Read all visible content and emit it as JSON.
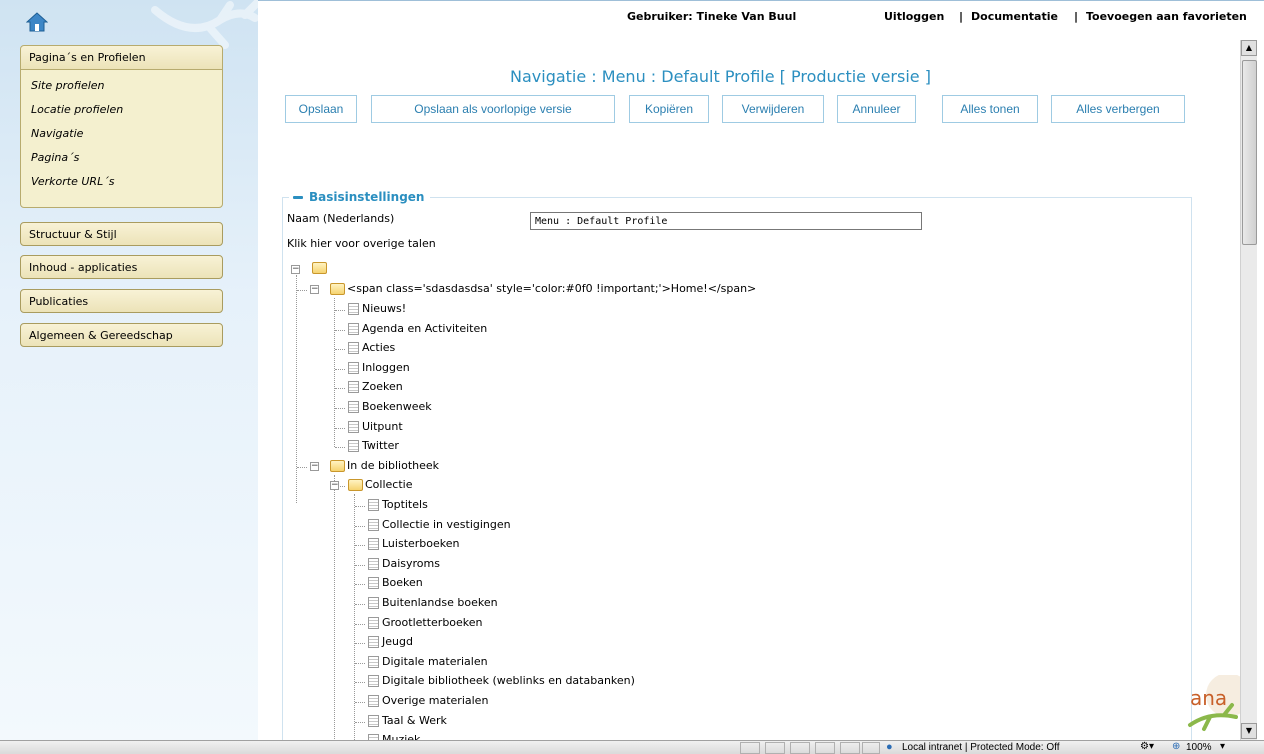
{
  "topbar": {
    "user": "Gebruiker: Tineke Van Buul",
    "logout": "Uitloggen",
    "sep1": "|",
    "docs": "Documentatie",
    "sep2": "|",
    "favorites": "Toevoegen aan favorieten"
  },
  "sidebar": {
    "panel_title": "Pagina´s en Profielen",
    "items": [
      "Site profielen",
      "Locatie profielen",
      "Navigatie",
      "Pagina´s",
      "Verkorte URL´s"
    ],
    "buttons": [
      "Structuur & Stijl",
      "Inhoud - applicaties",
      "Publicaties",
      "Algemeen & Gereedschap"
    ]
  },
  "main": {
    "title": "Navigatie : Menu : Default Profile [ Productie versie ]",
    "toolbar": [
      "Opslaan",
      "Opslaan als voorlopige versie",
      "Kopiëren",
      "Verwijderen",
      "Annuleer",
      "Alles tonen",
      "Alles verbergen"
    ],
    "section_title": "Basisinstellingen",
    "name_label": "Naam (Nederlands)",
    "name_value": "Menu : Default Profile",
    "other_languages": "Klik hier voor overige talen"
  },
  "tree": {
    "home": "<span class='sdasdasdsa' style='color:#0f0 !important;'>Home!</span>",
    "home_children": [
      "Nieuws!",
      "Agenda en Activiteiten",
      "Acties",
      "Inloggen",
      "Zoeken",
      "Boekenweek",
      "Uitpunt",
      "Twitter"
    ],
    "library": "In de bibliotheek",
    "collection": "Collectie",
    "collection_children": [
      "Toptitels",
      "Collectie in vestigingen",
      "Luisterboeken",
      "Daisyroms",
      "Boeken",
      "Buitenlandse boeken",
      "Grootletterboeken",
      "Jeugd",
      "Digitale materialen",
      "Digitale bibliotheek (weblinks en databanken)",
      "Overige materialen",
      "Taal & Werk",
      "Muziek"
    ]
  },
  "statusbar": {
    "zone": "Local intranet | Protected Mode: Off",
    "zoom": "100%"
  },
  "logo_text": "ana",
  "colors": {
    "accent": "#2b8fc0",
    "sidebar_button": "#ece3b8"
  }
}
